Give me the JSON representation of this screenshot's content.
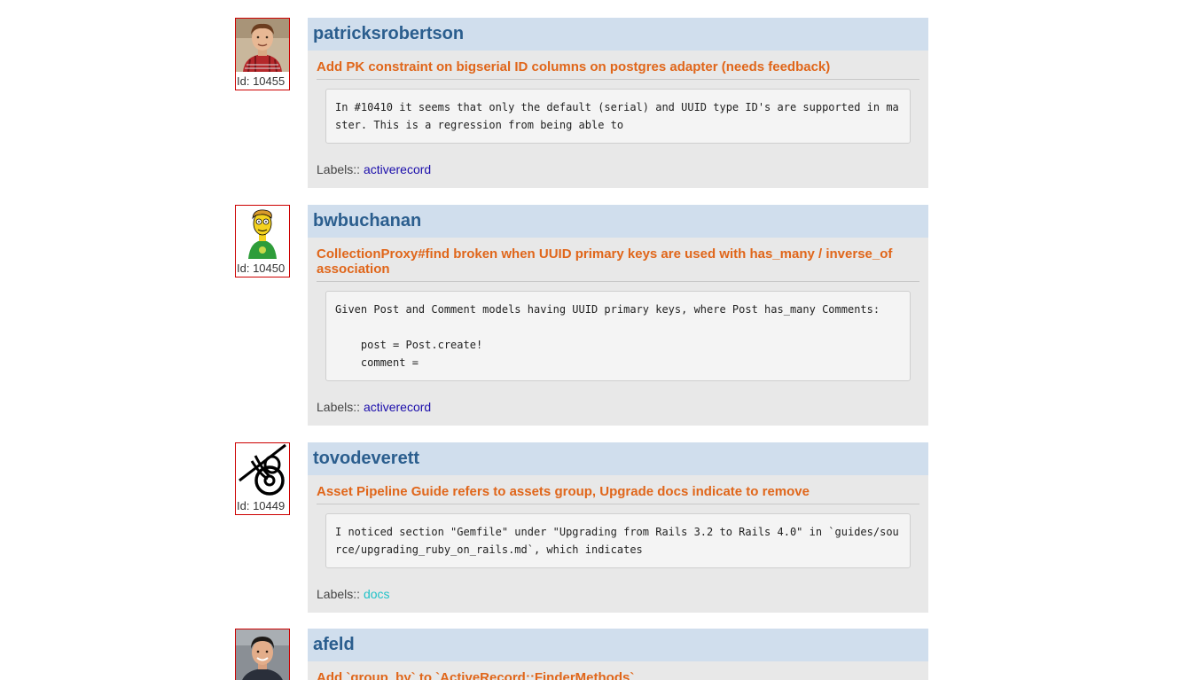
{
  "issues": [
    {
      "username": "patricksrobertson",
      "avatar_icon": "avatar-photo-man-red-plaid-shirt",
      "id_label": "Id: 10455",
      "title": "Add PK constraint on bigserial ID columns on postgres adapter (needs feedback)",
      "body": "In #10410 it seems that only the default (serial) and UUID type ID's are supported in master. This is a regression from being able to",
      "labels_prefix": "Labels::",
      "labels": [
        {
          "name": "activerecord",
          "color": "#1a0dab"
        }
      ]
    },
    {
      "username": "bwbuchanan",
      "avatar_icon": "avatar-cartoon-blond-man-green-shirt",
      "id_label": "Id: 10450",
      "title": "CollectionProxy#find broken when UUID primary keys are used with has_many / inverse_of association",
      "body": "Given Post and Comment models having UUID primary keys, where Post has_many Comments:\n\n    post = Post.create!\n    comment =",
      "labels_prefix": "Labels::",
      "labels": [
        {
          "name": "activerecord",
          "color": "#1a0dab"
        }
      ]
    },
    {
      "username": "tovodeverett",
      "avatar_icon": "avatar-black-line-knot-logo",
      "id_label": "Id: 10449",
      "title": "Asset Pipeline Guide refers to assets group, Upgrade docs indicate to remove",
      "body": "I noticed section \"Gemfile\" under \"Upgrading from Rails 3.2 to Rails 4.0\" in `guides/source/upgrading_ruby_on_rails.md`, which indicates",
      "labels_prefix": "Labels::",
      "labels": [
        {
          "name": "docs",
          "color": "#20c2c8"
        }
      ]
    },
    {
      "username": "afeld",
      "avatar_icon": "avatar-photo-dark-haired-man",
      "id_label": "",
      "title": "Add `group_by` to `ActiveRecord::FinderMethods`",
      "body": "",
      "labels_prefix": "",
      "labels": []
    }
  ]
}
